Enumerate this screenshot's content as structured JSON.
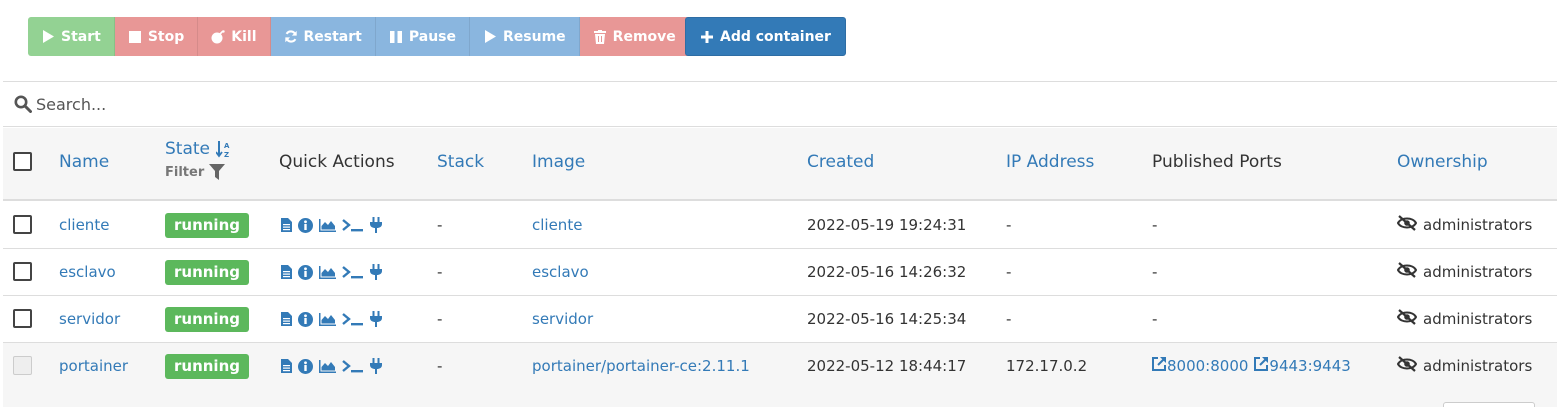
{
  "toolbar": {
    "start": "Start",
    "stop": "Stop",
    "kill": "Kill",
    "restart": "Restart",
    "pause": "Pause",
    "resume": "Resume",
    "remove": "Remove",
    "add_container": "Add container"
  },
  "search": {
    "placeholder": "Search..."
  },
  "table": {
    "headers": {
      "name": "Name",
      "state": "State",
      "state_filter": "Filter",
      "quick_actions": "Quick Actions",
      "stack": "Stack",
      "image": "Image",
      "created": "Created",
      "ip": "IP Address",
      "ports": "Published Ports",
      "ownership": "Ownership"
    },
    "rows": [
      {
        "name": "cliente",
        "state": "running",
        "stack": "-",
        "image": "cliente",
        "created": "2022-05-19 19:24:31",
        "ip": "-",
        "ports": "-",
        "ownership": "administrators"
      },
      {
        "name": "esclavo",
        "state": "running",
        "stack": "-",
        "image": "esclavo",
        "created": "2022-05-16 14:26:32",
        "ip": "-",
        "ports": "-",
        "ownership": "administrators"
      },
      {
        "name": "servidor",
        "state": "running",
        "stack": "-",
        "image": "servidor",
        "created": "2022-05-16 14:25:34",
        "ip": "-",
        "ports": "-",
        "ownership": "administrators"
      },
      {
        "name": "portainer",
        "state": "running",
        "stack": "-",
        "image": "portainer/portainer-ce:2.11.1",
        "created": "2022-05-12 18:44:17",
        "ip": "172.17.0.2",
        "port1": "8000:8000",
        "port2": "9443:9443",
        "ownership": "administrators"
      }
    ]
  },
  "icons": {
    "start": "play-icon",
    "stop": "stop-icon",
    "kill": "bomb-icon",
    "restart": "refresh-icon",
    "pause": "pause-icon",
    "resume": "play-icon",
    "remove": "trash-icon",
    "add": "plus-icon",
    "search": "search-icon",
    "sort": "sort-alpha-icon",
    "filter": "filter-icon",
    "logs": "file-icon",
    "inspect": "info-icon",
    "stats": "area-chart-icon",
    "console": "terminal-icon",
    "attach": "plug-icon",
    "ownership": "eye-slash-icon",
    "port": "external-link-icon"
  },
  "colors": {
    "primary": "#337ab7",
    "success": "#5cb85c",
    "danger_light": "#e89796",
    "info_light": "#8ab6df",
    "success_light": "#93d293"
  }
}
